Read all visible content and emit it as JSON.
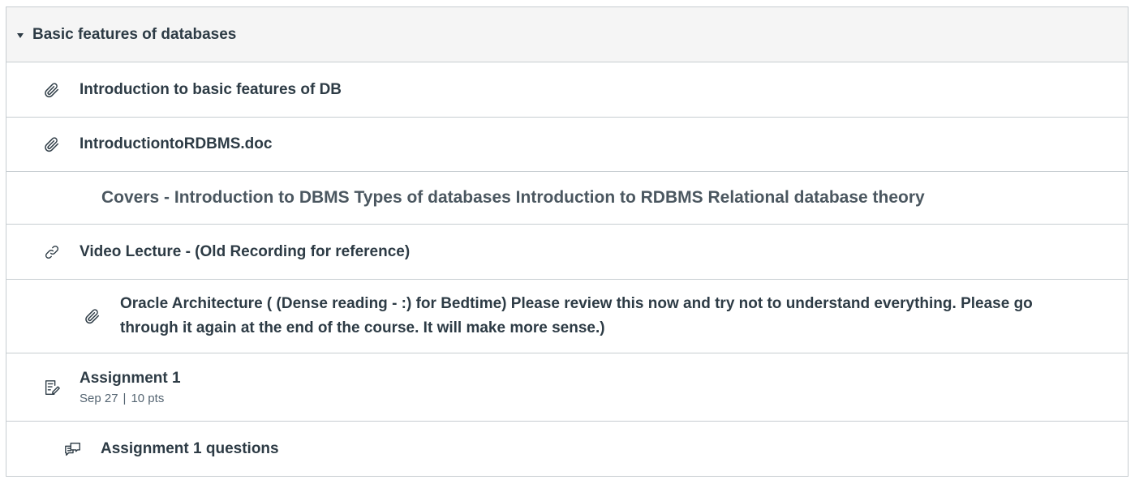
{
  "module": {
    "title": "Basic features of databases",
    "items": [
      {
        "type": "attachment",
        "title": "Introduction to basic features of DB"
      },
      {
        "type": "attachment",
        "title": "IntroductiontoRDBMS.doc"
      },
      {
        "type": "subheader",
        "title": "Covers - Introduction to DBMS Types of databases Introduction to RDBMS Relational database theory"
      },
      {
        "type": "link",
        "title": "Video Lecture - (Old Recording for reference)"
      },
      {
        "type": "attachment",
        "title_line1": "Oracle Architecture ( (Dense reading - :) for Bedtime) Please review this now and try not to understand everything. Please go",
        "title_line2": "through it again at the end of the course. It will make more sense.)"
      },
      {
        "type": "assignment",
        "title": "Assignment 1",
        "due": "Sep 27",
        "separator": "|",
        "points": "10 pts"
      },
      {
        "type": "discussion",
        "title": "Assignment 1 questions"
      }
    ]
  },
  "icons": {
    "caret": "caret-down-icon",
    "attachment": "paperclip-icon",
    "link": "link-icon",
    "assignment": "assignment-icon",
    "discussion": "discussion-icon"
  },
  "colors": {
    "text": "#2d3b45",
    "border": "#c7cdd1",
    "header_bg": "#f5f5f5",
    "subheader": "#4b5760",
    "meta": "#556572"
  }
}
